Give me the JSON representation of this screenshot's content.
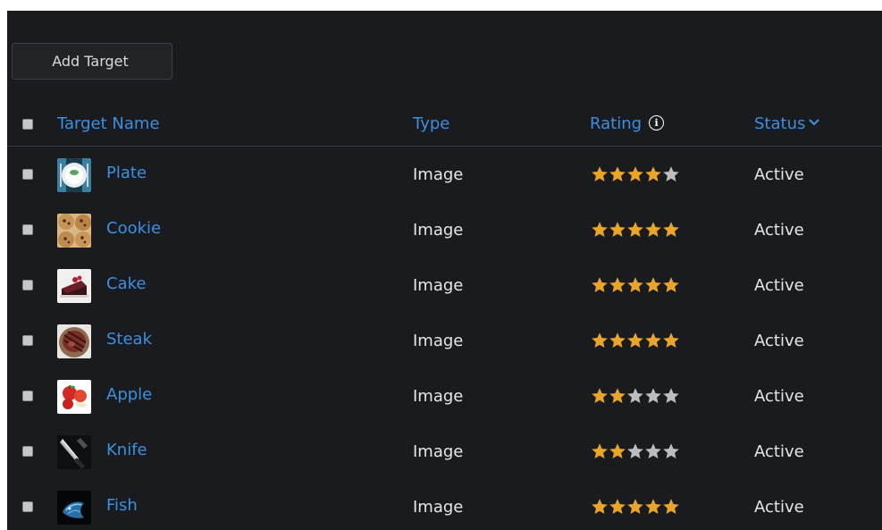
{
  "toolbar": {
    "add_target_label": "Add Target"
  },
  "table": {
    "columns": {
      "name": "Target Name",
      "type": "Type",
      "rating": "Rating",
      "status": "Status"
    },
    "rating_max": 5,
    "colors": {
      "link": "#3d8fe0",
      "star_filled": "#e8a52a",
      "star_empty": "#bdbdbd"
    },
    "rows": [
      {
        "name": "Plate",
        "type": "Image",
        "rating": 4,
        "status": "Active",
        "thumb_icon": "plate-thumbnail"
      },
      {
        "name": "Cookie",
        "type": "Image",
        "rating": 5,
        "status": "Active",
        "thumb_icon": "cookie-thumbnail"
      },
      {
        "name": "Cake",
        "type": "Image",
        "rating": 5,
        "status": "Active",
        "thumb_icon": "cake-thumbnail"
      },
      {
        "name": "Steak",
        "type": "Image",
        "rating": 5,
        "status": "Active",
        "thumb_icon": "steak-thumbnail"
      },
      {
        "name": "Apple",
        "type": "Image",
        "rating": 2,
        "status": "Active",
        "thumb_icon": "apple-thumbnail"
      },
      {
        "name": "Knife",
        "type": "Image",
        "rating": 2,
        "status": "Active",
        "thumb_icon": "knife-thumbnail"
      },
      {
        "name": "Fish",
        "type": "Image",
        "rating": 5,
        "status": "Active",
        "thumb_icon": "fish-thumbnail"
      }
    ]
  }
}
